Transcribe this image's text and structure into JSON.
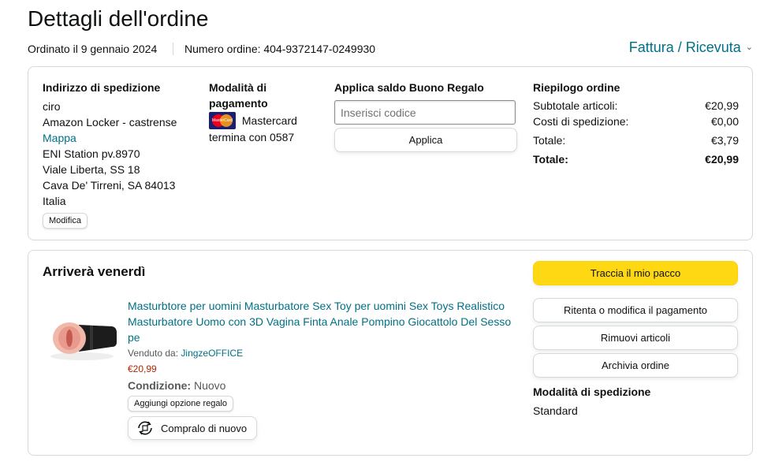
{
  "page": {
    "title": "Dettagli dell'ordine",
    "ordered_on": "Ordinato il 9 gennaio 2024",
    "order_number": "Numero ordine: 404-9372147-0249930",
    "invoice_label": "Fattura / Ricevuta"
  },
  "shipping": {
    "heading": "Indirizzo di spedizione",
    "name": "ciro",
    "locker": "Amazon Locker - castrense",
    "map_link": "Mappa",
    "station": "ENI Station pv.8970",
    "street": "Viale Liberta, SS 18",
    "city": "Cava De' Tirreni, SA 84013",
    "country": "Italia",
    "edit_label": "Modifica"
  },
  "payment": {
    "heading": "Modalità di pagamento",
    "card_name": "Mastercard",
    "card_logo_text": "MasterCard",
    "card_ending": "termina con 0587"
  },
  "gift": {
    "heading": "Applica saldo Buono Regalo",
    "placeholder": "Inserisci codice",
    "apply_label": "Applica"
  },
  "summary": {
    "heading": "Riepilogo ordine",
    "rows": [
      {
        "label": "Subtotale articoli:",
        "value": "€20,99"
      },
      {
        "label": "Costi di spedizione:",
        "value": "€0,00"
      },
      {
        "label": "Totale:",
        "value": "€3,79"
      }
    ],
    "total_label": "Totale:",
    "total_value": "€20,99"
  },
  "shipment": {
    "heading": "Arriverà venerdì",
    "product_title": "Masturbtore per uomini Masturbatore Sex Toy per uomini Sex Toys Realistico Masturbatore Uomo con 3D Vagina Finta Anale Pompino Giocattolo Del Sesso pe",
    "sold_by_label": "Venduto da:",
    "seller": "JingzeOFFICE",
    "price": "€20,99",
    "condition_label": "Condizione:",
    "condition_value": "Nuovo",
    "gift_option_label": "Aggiungi opzione regalo",
    "buy_again_label": "Compralo di nuovo",
    "track_label": "Traccia il mio pacco",
    "retry_payment_label": "Ritenta o modifica il pagamento",
    "remove_items_label": "Rimuovi articoli",
    "archive_label": "Archivia ordine",
    "shipping_method_heading": "Modalità di spedizione",
    "shipping_method_value": "Standard"
  },
  "colors": {
    "link": "#007185",
    "price": "#b12704",
    "track_button": "#ffd814",
    "border": "#d5d9d9"
  },
  "icons": {
    "invoice_chevron": "chevron-down-icon",
    "buy_again": "buy-again-icon",
    "card": "mastercard-icon"
  }
}
